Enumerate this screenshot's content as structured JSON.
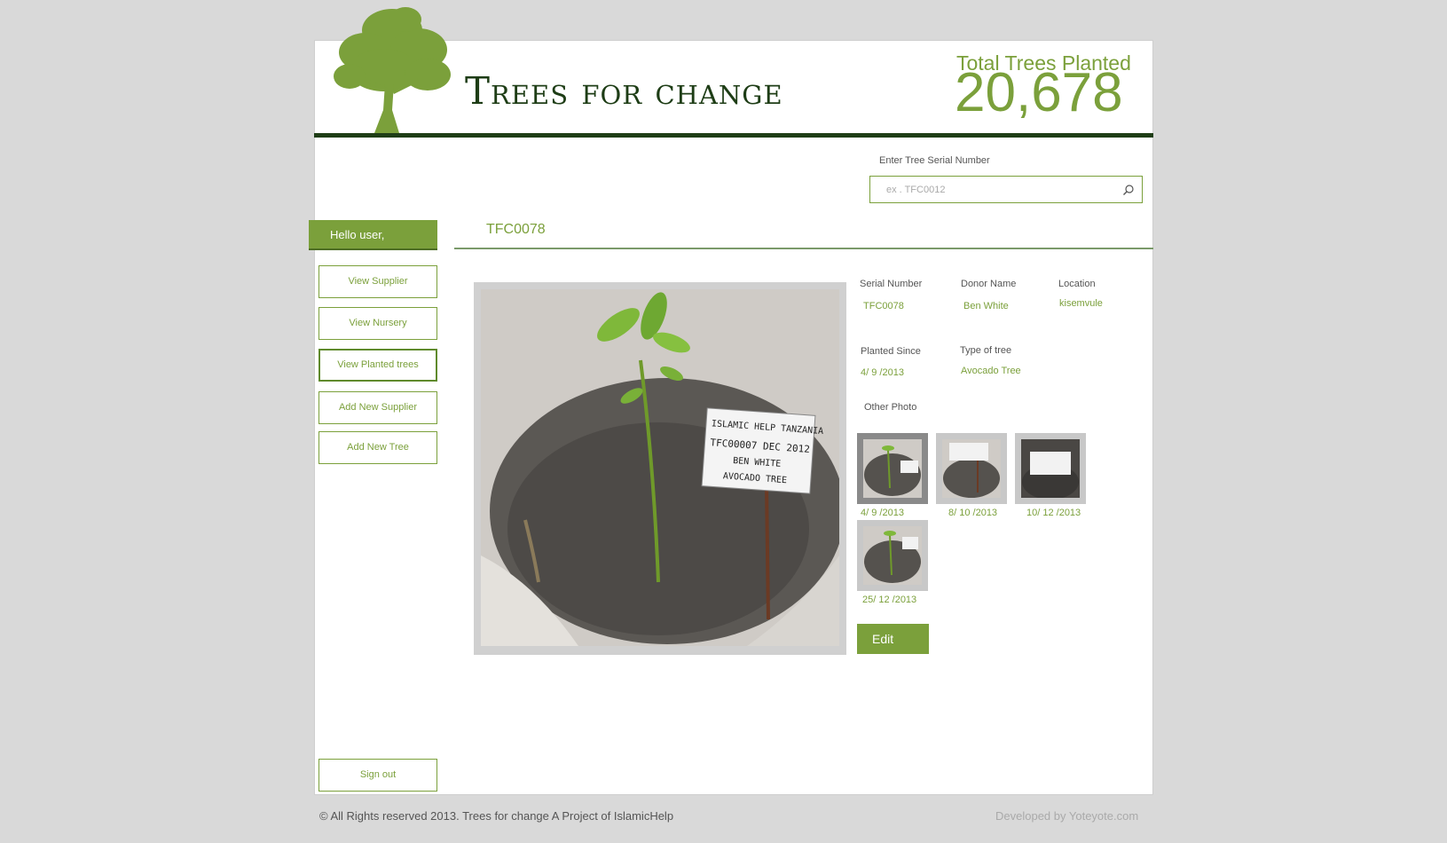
{
  "header": {
    "brand_title": "Trees for change",
    "counter_label": "Total Trees Planted",
    "counter_value": "20,678"
  },
  "search": {
    "label": "Enter Tree Serial Number",
    "placeholder": "ex . TFC0012"
  },
  "sidebar": {
    "greeting": "Hello user,",
    "items": [
      {
        "label": "View Supplier"
      },
      {
        "label": "View Nursery"
      },
      {
        "label": "View Planted trees"
      },
      {
        "label": "Add New Supplier"
      },
      {
        "label": "Add New Tree"
      }
    ],
    "active_item": "View Planted trees",
    "signout_label": "Sign out"
  },
  "record": {
    "title": "TFC0078",
    "fields": {
      "serial_label": "Serial Number",
      "serial_value": "TFC0078",
      "donor_label": "Donor Name",
      "donor_value": "Ben White",
      "location_label": "Location",
      "location_value": "kisemvule",
      "planted_label": "Planted Since",
      "planted_value": "4/ 9 /2013",
      "type_label": "Type of tree",
      "type_value": "Avocado Tree"
    },
    "photo_sign": {
      "line1": "ISLAMIC HELP TANZANIA",
      "line2": "TFC00007  DEC 2012",
      "line3": "BEN WHITE",
      "line4": "AVOCADO TREE"
    },
    "other_photo_label": "Other Photo",
    "other_photos": [
      {
        "date": "4/ 9 /2013"
      },
      {
        "date": "8/ 10 /2013"
      },
      {
        "date": "10/ 12 /2013"
      },
      {
        "date": "25/ 12 /2013"
      }
    ],
    "edit_label": "Edit"
  },
  "footer": {
    "copyright": "© All Rights reserved 2013. Trees for change A Project of IslamicHelp",
    "developer": "Developed by Yoteyote.com"
  },
  "colors": {
    "accent": "#7ba03b",
    "dark_green": "#1e3d16",
    "background": "#d9d9d9"
  }
}
